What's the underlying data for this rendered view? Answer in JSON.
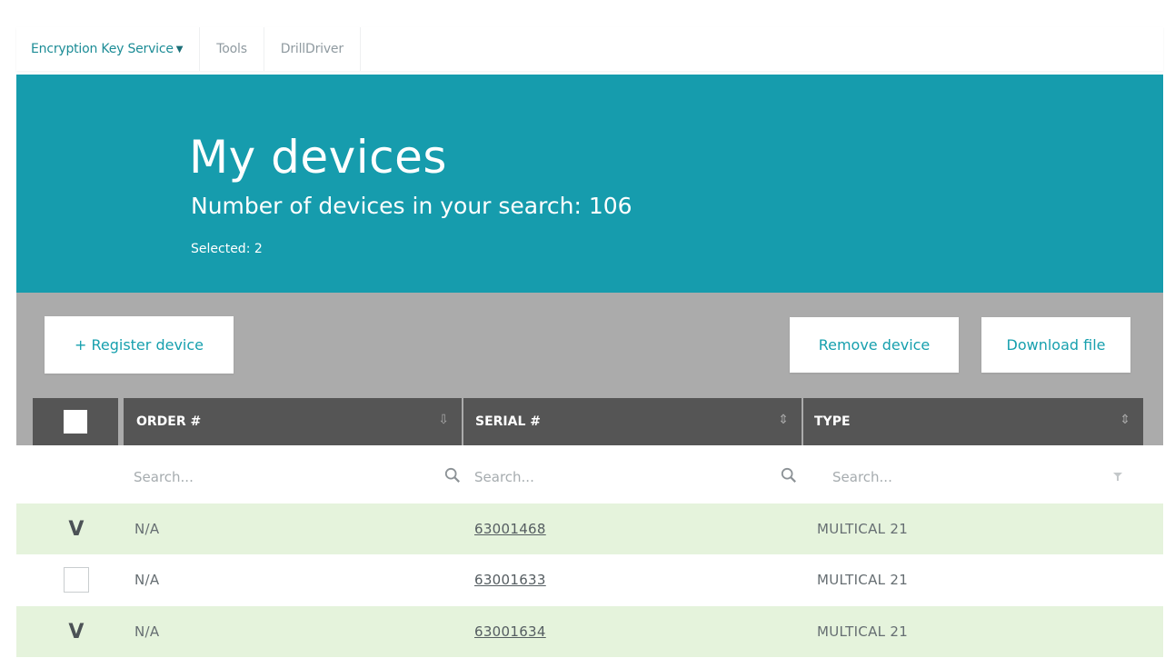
{
  "nav": {
    "items": [
      {
        "label": "Encryption Key Service",
        "active": true,
        "has_caret": true
      },
      {
        "label": "Tools",
        "active": false
      },
      {
        "label": "DrillDriver",
        "active": false
      }
    ]
  },
  "hero": {
    "title": "My devices",
    "subtitle": "Number of devices in your search: 106",
    "selected": "Selected: 2",
    "background": "#169cad"
  },
  "toolbar": {
    "register_label": "+ Register device",
    "remove_label": "Remove device",
    "download_label": "Download file",
    "accent": "#17a0ae"
  },
  "table": {
    "columns": [
      {
        "label": "ORDER #",
        "sort_icon": "sort-icon"
      },
      {
        "label": "SERIAL #",
        "sort_icon": "sort-icon"
      },
      {
        "label": "TYPE",
        "sort_icon": "sort-both-icon"
      }
    ],
    "search": {
      "order_placeholder": "Search...",
      "serial_placeholder": "Search...",
      "type_placeholder": "Search..."
    },
    "rows": [
      {
        "checked": true,
        "order": "N/A",
        "serial": "63001468",
        "type": "MULTICAL 21"
      },
      {
        "checked": false,
        "order": "N/A",
        "serial": "63001633",
        "type": "MULTICAL 21"
      },
      {
        "checked": true,
        "order": "N/A",
        "serial": "63001634",
        "type": "MULTICAL 21"
      }
    ],
    "selected_row_color": "#e5f3dc",
    "header_color": "#555555"
  }
}
